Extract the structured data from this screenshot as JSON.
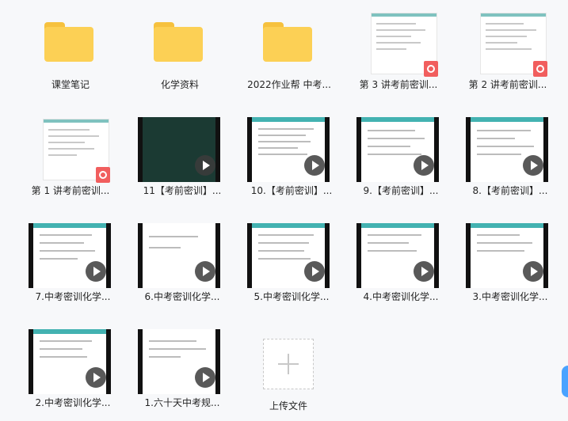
{
  "items": [
    {
      "type": "folder",
      "name": "课堂笔记"
    },
    {
      "type": "folder",
      "name": "化学资料"
    },
    {
      "type": "folder",
      "name": "2022作业帮 中考..."
    },
    {
      "type": "pdf",
      "name": "第 3 讲考前密训..."
    },
    {
      "type": "pdf",
      "name": "第 2 讲考前密训..."
    },
    {
      "type": "pdf",
      "name": "第 1 讲考前密训..."
    },
    {
      "type": "video",
      "name": "11【考前密训】..."
    },
    {
      "type": "video",
      "name": "10.【考前密训】..."
    },
    {
      "type": "video",
      "name": "9.【考前密训】..."
    },
    {
      "type": "video",
      "name": "8.【考前密训】..."
    },
    {
      "type": "video",
      "name": "7.中考密训化学..."
    },
    {
      "type": "video",
      "name": "6.中考密训化学..."
    },
    {
      "type": "video",
      "name": "5.中考密训化学..."
    },
    {
      "type": "video",
      "name": "4.中考密训化学..."
    },
    {
      "type": "video",
      "name": "3.中考密训化学..."
    },
    {
      "type": "video",
      "name": "2.中考密训化学..."
    },
    {
      "type": "video",
      "name": "1.六十天中考规..."
    }
  ],
  "upload": {
    "label": "上传文件"
  },
  "colors": {
    "folder": "#fcd055",
    "pdf_badge": "#f15e5e",
    "accent": "#43b2b1"
  }
}
